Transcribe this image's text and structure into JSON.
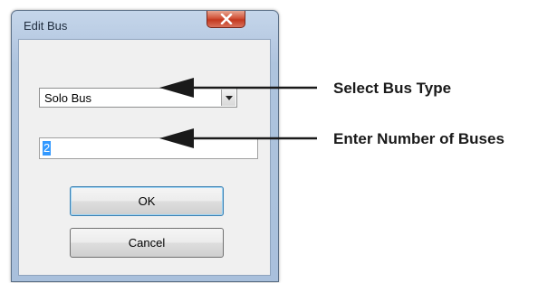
{
  "window": {
    "title": "Edit Bus",
    "close_icon": "close-icon"
  },
  "bus_type": {
    "selected": "Solo Bus",
    "arrow_icon": "chevron-down-icon"
  },
  "bus_count": {
    "value": "2"
  },
  "buttons": {
    "ok": "OK",
    "cancel": "Cancel"
  },
  "annotations": {
    "select_type": "Select Bus Type",
    "enter_number": "Enter Number of Buses"
  }
}
